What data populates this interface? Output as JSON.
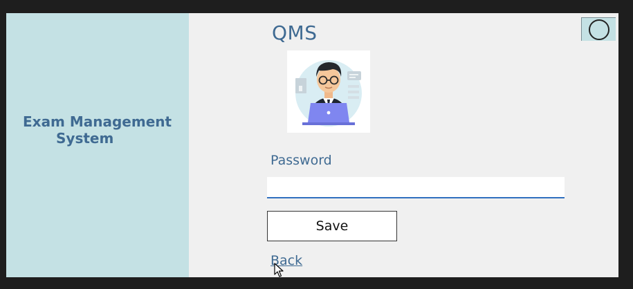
{
  "sidebar": {
    "title_line1": "Exam Management",
    "title_line2": "System"
  },
  "header": {
    "app_title": "QMS"
  },
  "form": {
    "password_label": "Password",
    "password_value": "",
    "save_label": "Save",
    "back_label": "Back"
  },
  "icons": {
    "avatar": "developer-at-laptop-avatar-icon",
    "corner": "circle-icon",
    "cursor": "mouse-pointer-icon"
  },
  "colors": {
    "sidebar_bg": "#c4e1e4",
    "accent_text": "#3f6a92",
    "input_underline": "#2f6fbf"
  }
}
